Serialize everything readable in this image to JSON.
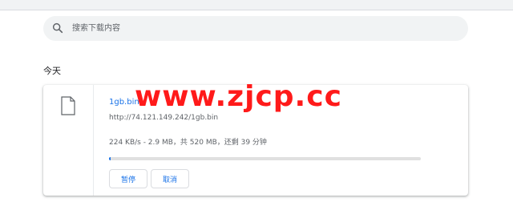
{
  "search": {
    "placeholder": "搜索下载内容",
    "icon": "search-icon"
  },
  "section": {
    "title": "今天"
  },
  "download": {
    "file_icon": "file-icon",
    "file_name": "1gb.bin",
    "url": "http://74.121.149.242/1gb.bin",
    "progress_text": "224 KB/s - 2.9 MB，共 520 MB，还剩 39 分钟",
    "progress_fraction": 0.0056,
    "pause_label": "暂停",
    "cancel_label": "取消"
  },
  "watermark": {
    "text": "www.zjcp.cc"
  },
  "colors": {
    "accent": "#1a73e8",
    "watermark": "#ff1a1a"
  }
}
